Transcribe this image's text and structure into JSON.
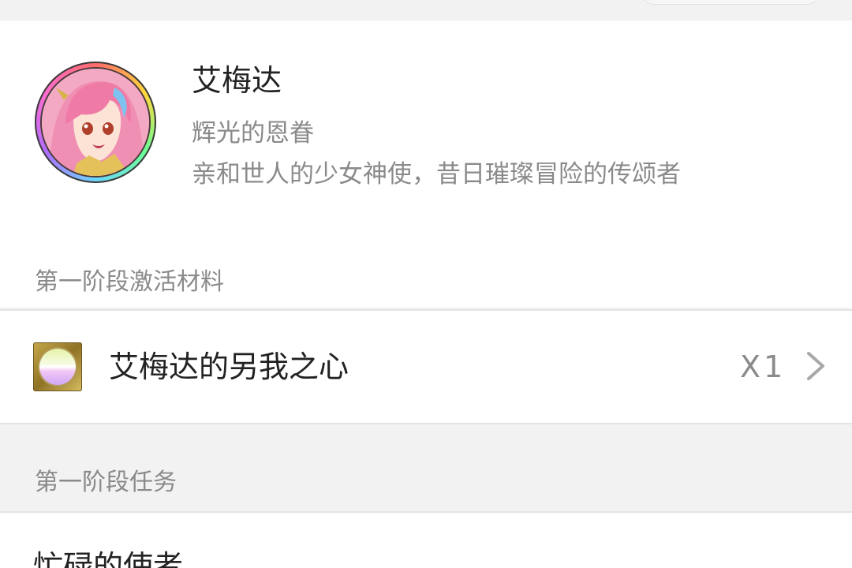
{
  "hero": {
    "name": "艾梅达",
    "title": "辉光的恩眷",
    "description": "亲和世人的少女神使，昔日璀璨冒险的传颂者",
    "avatar_icon": "anime-girl-portrait-icon"
  },
  "sections": {
    "materials_label": "第一阶段激活材料",
    "tasks_label": "第一阶段任务"
  },
  "material": {
    "name": "艾梅达的另我之心",
    "quantity": "X1",
    "icon": "heart-gem-icon"
  },
  "task": {
    "name": "忙碌的使者"
  },
  "colors": {
    "background": "#f2f2f2",
    "card": "#ffffff",
    "primary_text": "#222222",
    "secondary_text": "#8a8a8a",
    "divider": "#e4e4e4"
  }
}
